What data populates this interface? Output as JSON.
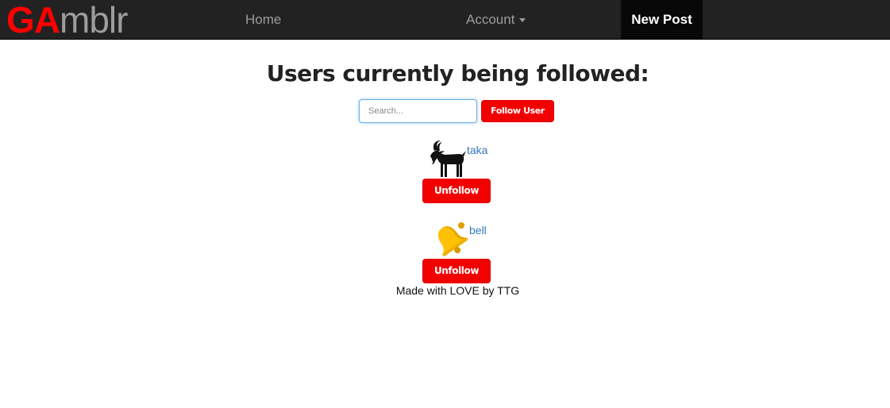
{
  "nav": {
    "brand_highlight": "GA",
    "brand_rest": "mblr",
    "home_label": "Home",
    "account_label": "Account",
    "new_post_label": "New Post"
  },
  "main": {
    "title": "Users currently being followed:",
    "search_placeholder": "Search...",
    "follow_button_label": "Follow User",
    "users": [
      {
        "name": "taka",
        "avatar_icon": "goat-icon",
        "unfollow_label": "Unfollow"
      },
      {
        "name": "bell",
        "avatar_icon": "bell-icon",
        "unfollow_label": "Unfollow"
      }
    ]
  },
  "footer": {
    "text": "Made with LOVE by TTG"
  },
  "colors": {
    "navbar_bg": "#222222",
    "brand_red": "#ff0000",
    "button_red": "#f20000",
    "link_blue": "#337ab7"
  }
}
